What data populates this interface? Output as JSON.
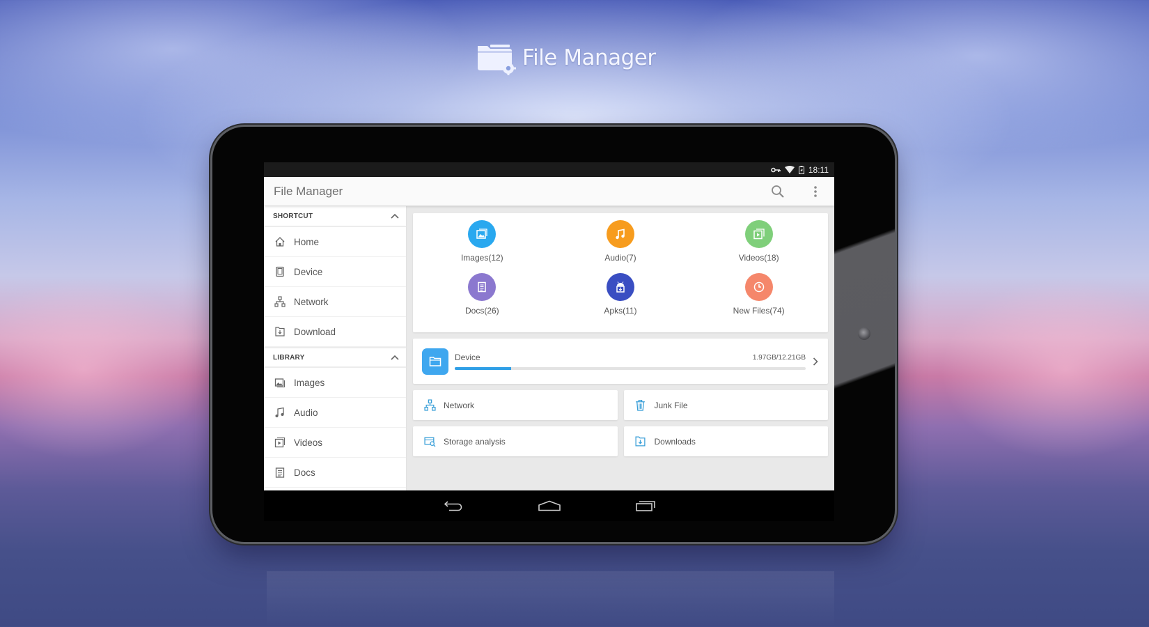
{
  "brand": {
    "title": "File Manager",
    "icon": "folder-gear-icon"
  },
  "statusbar": {
    "icons": [
      "vpn-key-icon",
      "wifi-icon",
      "battery-charging-icon"
    ],
    "time": "18:11"
  },
  "appbar": {
    "title": "File Manager",
    "search_icon": "search-icon",
    "menu_icon": "more-vert-icon"
  },
  "sidebar": {
    "sections": [
      {
        "header": "SHORTCUT",
        "collapse_icon": "chevron-up-icon",
        "items": [
          {
            "label": "Home",
            "icon": "home-icon"
          },
          {
            "label": "Device",
            "icon": "device-icon"
          },
          {
            "label": "Network",
            "icon": "network-icon"
          },
          {
            "label": "Download",
            "icon": "download-icon"
          }
        ]
      },
      {
        "header": "LIBRARY",
        "collapse_icon": "chevron-up-icon",
        "items": [
          {
            "label": "Images",
            "icon": "image-icon"
          },
          {
            "label": "Audio",
            "icon": "music-note-icon"
          },
          {
            "label": "Videos",
            "icon": "video-icon"
          },
          {
            "label": "Docs",
            "icon": "document-icon"
          }
        ]
      }
    ]
  },
  "categories": [
    {
      "label": "Images(12)",
      "icon": "image-icon",
      "color": "#29a8ef"
    },
    {
      "label": "Audio(7)",
      "icon": "music-note-icon",
      "color": "#f79c1e"
    },
    {
      "label": "Videos(18)",
      "icon": "video-icon",
      "color": "#7fcf7a"
    },
    {
      "label": "Docs(26)",
      "icon": "document-icon",
      "color": "#8b78cf"
    },
    {
      "label": "Apks(11)",
      "icon": "android-package-icon",
      "color": "#3a4ec2"
    },
    {
      "label": "New Files(74)",
      "icon": "clock-icon",
      "color": "#f5876b"
    }
  ],
  "storage": {
    "name": "Device",
    "used": "1.97GB",
    "total": "12.21GB",
    "size_text": "1.97GB/12.21GB",
    "used_fraction": 0.16,
    "accent": "#2f9fe6"
  },
  "tiles": [
    {
      "label": "Network",
      "icon": "network-icon"
    },
    {
      "label": "Junk File",
      "icon": "trash-icon"
    },
    {
      "label": "Storage analysis",
      "icon": "storage-analysis-icon"
    },
    {
      "label": "Downloads",
      "icon": "download-icon"
    }
  ],
  "navbar": {
    "back": "back-icon",
    "home": "home-nav-icon",
    "recents": "recents-icon"
  }
}
